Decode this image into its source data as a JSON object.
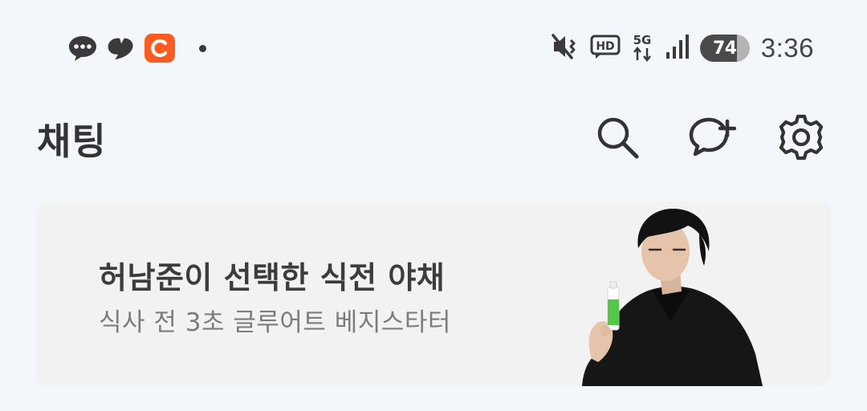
{
  "status_bar": {
    "notification_icons": [
      "chat-bubble-icon",
      "thread-swirl-icon",
      "coupang-c-icon"
    ],
    "coupang_badge_color": "#ff5a1f",
    "system_icons": [
      "mute-vibrate-icon",
      "hd-voice-icon",
      "5g-icon",
      "signal-icon"
    ],
    "network_label": "5G",
    "hd_label": "HD",
    "battery": "74",
    "time": "3:36"
  },
  "header": {
    "title": "채팅",
    "actions": [
      "search-icon",
      "new-chat-icon",
      "settings-icon"
    ]
  },
  "ad_banner": {
    "headline": "허남준이 선택한 식전 야채",
    "subtext": "식사 전 3초 글루어트 베지스타터"
  }
}
